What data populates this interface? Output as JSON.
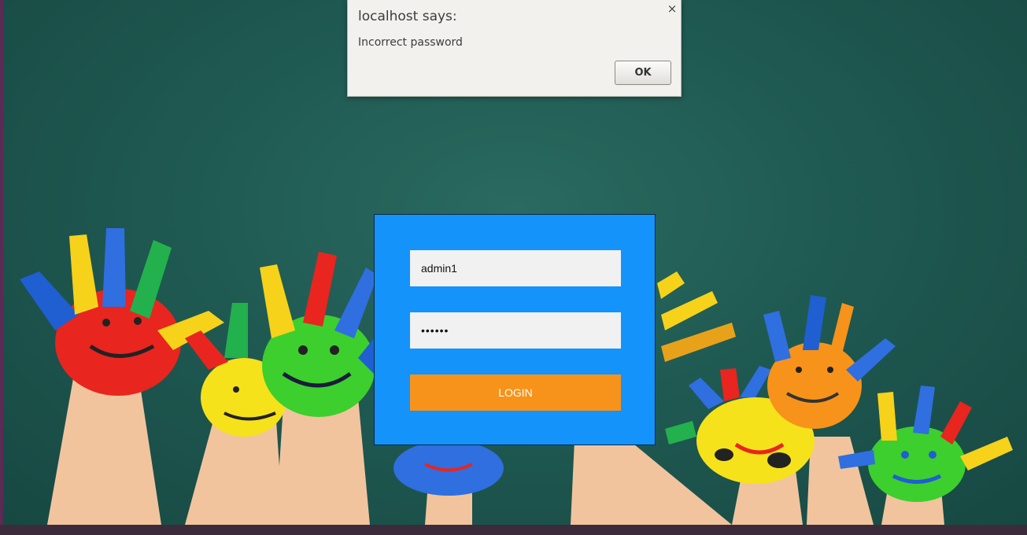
{
  "dialog": {
    "title": "localhost says:",
    "message": "Incorrect password",
    "close_glyph": "×",
    "ok_label": "OK"
  },
  "login": {
    "username_value": "admin1",
    "password_value": "••••••",
    "button_label": "LOGIN"
  },
  "colors": {
    "panel": "#1493fb",
    "button": "#f7931a",
    "chalkboard": "#1f5a52"
  }
}
